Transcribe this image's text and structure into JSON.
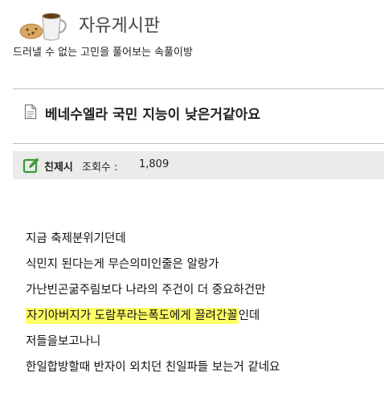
{
  "board": {
    "title": "자유게시판",
    "description": "드러낼 수 없는 고민을 풀어보는 속풀이방"
  },
  "post": {
    "title": "베네수엘라 국민 지능이 낮은거같아요",
    "author": "친제시",
    "views_label": "조회수 :",
    "views_value": "1,809",
    "lines": [
      {
        "text": "지금 축제분위기던데"
      },
      {
        "text": "식민지 된다는게 무슨의미인줄은 알랑가"
      },
      {
        "text": "가난빈곤굶주림보다 나라의 주건이 더 중요하건만"
      },
      {
        "highlight": "자기아버지가 도람푸라는폭도에게  끌려간꼴",
        "rest": "인데"
      },
      {
        "text": "저들을보고나니"
      },
      {
        "text": "한일합방할때 반자이 외치던 친일파들 보는거 같네요"
      }
    ]
  },
  "colors": {
    "highlight": "#ffff66",
    "meta_bar": "#ebebeb",
    "edit_icon": "#3a9a3a"
  }
}
